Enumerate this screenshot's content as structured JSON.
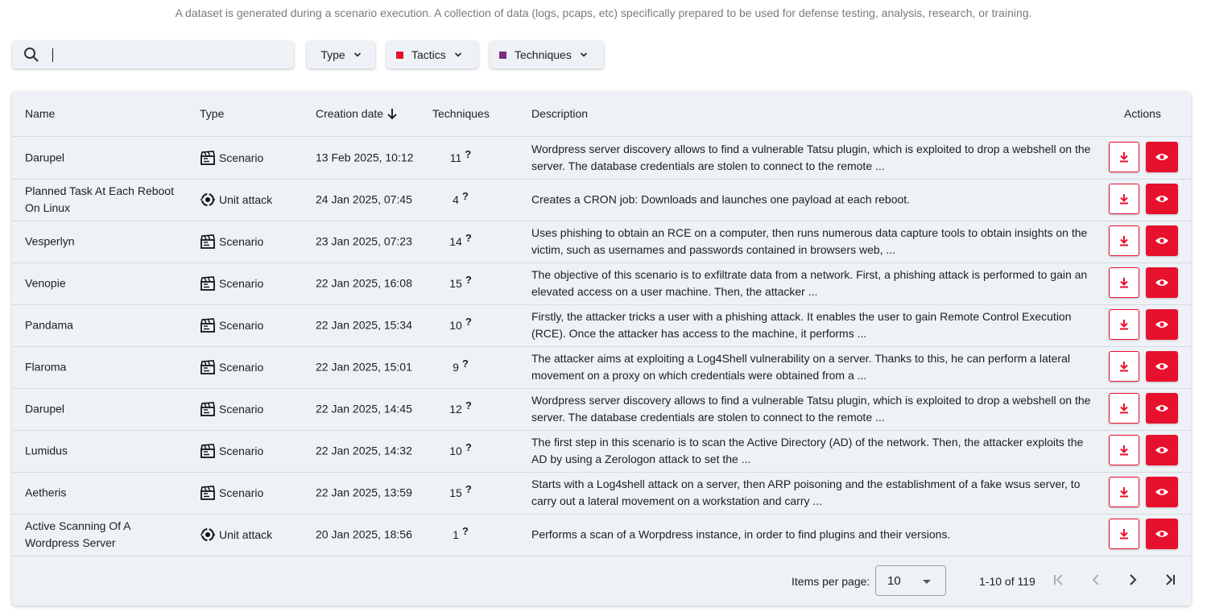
{
  "intro": "A dataset is generated during a scenario execution. A collection of data (logs, pcaps, etc) specifically prepared to be used for defense testing, analysis, research, or training.",
  "search": {
    "value": "",
    "placeholder": ""
  },
  "filters": {
    "type_label": "Type",
    "tactics_label": "Tactics",
    "tactics_color": "#e8112d",
    "techniques_label": "Techniques",
    "techniques_color": "#7b2e7e"
  },
  "columns": {
    "name": "Name",
    "type": "Type",
    "creation_date": "Creation date",
    "techniques": "Techniques",
    "description": "Description",
    "actions": "Actions"
  },
  "rows": [
    {
      "name": "Darupel",
      "type": "Scenario",
      "type_icon": "clapperboard-icon",
      "date": "13 Feb 2025, 10:12",
      "techniques": "11",
      "description": "Wordpress server discovery allows to find a vulnerable Tatsu plugin, which is exploited to drop a webshell on the server. The database credentials are stolen to connect to the remote ..."
    },
    {
      "name": "Planned Task At Each Reboot On Linux",
      "type": "Unit attack",
      "type_icon": "target-icon",
      "date": "24 Jan 2025, 07:45",
      "techniques": "4",
      "description": "Creates a CRON job: Downloads and launches one payload at each reboot."
    },
    {
      "name": "Vesperlyn",
      "type": "Scenario",
      "type_icon": "clapperboard-icon",
      "date": "23 Jan 2025, 07:23",
      "techniques": "14",
      "description": "Uses phishing to obtain an RCE on a computer, then runs numerous data capture tools to obtain insights on the victim, such as usernames and passwords contained in browsers web, ..."
    },
    {
      "name": "Venopie",
      "type": "Scenario",
      "type_icon": "clapperboard-icon",
      "date": "22 Jan 2025, 16:08",
      "techniques": "15",
      "description": "The objective of this scenario is to exfiltrate data from a network. First, a phishing attack is performed to gain an elevated access on a user machine. Then, the attacker ..."
    },
    {
      "name": "Pandama",
      "type": "Scenario",
      "type_icon": "clapperboard-icon",
      "date": "22 Jan 2025, 15:34",
      "techniques": "10",
      "description": "Firstly, the attacker tricks a user with a phishing attack. It enables the user to gain Remote Control Execution (RCE). Once the attacker has access to the machine, it performs ..."
    },
    {
      "name": "Flaroma",
      "type": "Scenario",
      "type_icon": "clapperboard-icon",
      "date": "22 Jan 2025, 15:01",
      "techniques": "9",
      "description": "The attacker aims at exploiting a Log4Shell vulnerability on a server. Thanks to this, he can perform a lateral movement on a proxy on which credentials were obtained from a ..."
    },
    {
      "name": "Darupel",
      "type": "Scenario",
      "type_icon": "clapperboard-icon",
      "date": "22 Jan 2025, 14:45",
      "techniques": "12",
      "description": "Wordpress server discovery allows to find a vulnerable Tatsu plugin, which is exploited to drop a webshell on the server. The database credentials are stolen to connect to the remote ..."
    },
    {
      "name": "Lumidus",
      "type": "Scenario",
      "type_icon": "clapperboard-icon",
      "date": "22 Jan 2025, 14:32",
      "techniques": "10",
      "description": "The first step in this scenario is to scan the Active Directory (AD) of the network. Then, the attacker exploits the AD by using a Zerologon attack to set the ..."
    },
    {
      "name": "Aetheris",
      "type": "Scenario",
      "type_icon": "clapperboard-icon",
      "date": "22 Jan 2025, 13:59",
      "techniques": "15",
      "description": "Starts with a Log4shell attack on a server, then ARP poisoning and the establishment of a fake wsus server, to carry out a lateral movement on a workstation and carry ..."
    },
    {
      "name": "Active Scanning Of A Wordpress Server",
      "type": "Unit attack",
      "type_icon": "target-icon",
      "date": "20 Jan 2025, 18:56",
      "techniques": "1",
      "description": "Performs a scan of a Worpdress instance, in order to find plugins and their versions."
    }
  ],
  "techniques_hint": "?",
  "pagination": {
    "items_per_page_label": "Items per page:",
    "items_per_page": "10",
    "range": "1-10 of 119"
  },
  "colors": {
    "accent": "#e8112d",
    "surface": "#eef2f6"
  }
}
